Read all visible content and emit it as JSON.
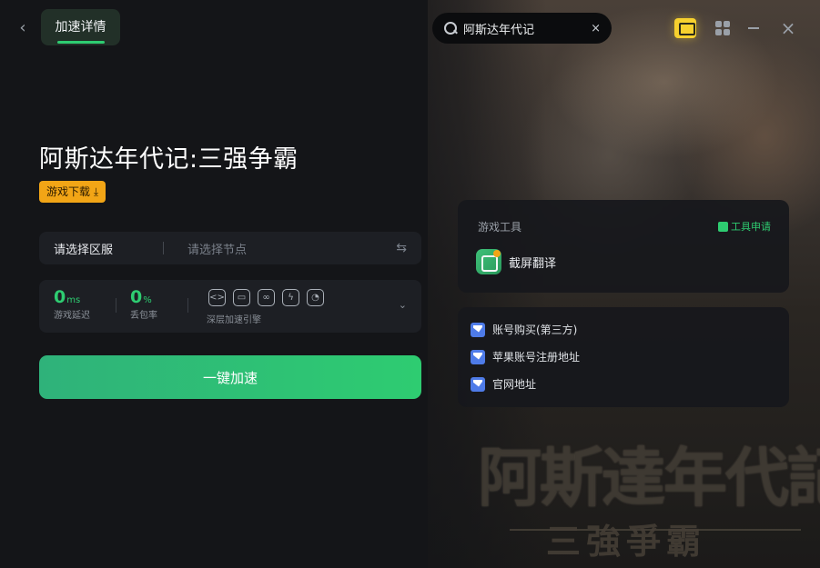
{
  "header": {
    "back_glyph": "‹",
    "tab_label": "加速详情",
    "search_value": "阿斯达年代记",
    "clear_glyph": "×",
    "close_glyph": "×"
  },
  "game": {
    "title": "阿斯达年代记:三强争霸",
    "download_label": "游戏下载 ⤓"
  },
  "region": {
    "label": "请选择区服",
    "node_placeholder": "请选择节点",
    "swap_glyph": "⇆"
  },
  "stats": {
    "latency_value": "0",
    "latency_unit": "ms",
    "latency_label": "游戏延迟",
    "loss_value": "0",
    "loss_unit": "%",
    "loss_label": "丢包率",
    "engine_label": "深层加速引擎",
    "engine_icons": [
      "code-icon",
      "screen-icon",
      "link-icon",
      "bolt-icon",
      "gauge-icon"
    ],
    "chevron_glyph": "⌄"
  },
  "accelerate_label": "一键加速",
  "tools": {
    "title": "游戏工具",
    "apply_label": "工具申请",
    "items": [
      {
        "label": "截屏翻译"
      }
    ]
  },
  "links": [
    {
      "label": "账号购买(第三方)"
    },
    {
      "label": "苹果账号注册地址"
    },
    {
      "label": "官网地址"
    }
  ],
  "background": {
    "title_art": "阿斯達年代記",
    "subtitle_art": "三強爭霸"
  },
  "colors": {
    "accent": "#2ecc71",
    "download_badge": "#f2a516",
    "gift": "#f7d12e",
    "link_icon": "#4e7be8"
  }
}
